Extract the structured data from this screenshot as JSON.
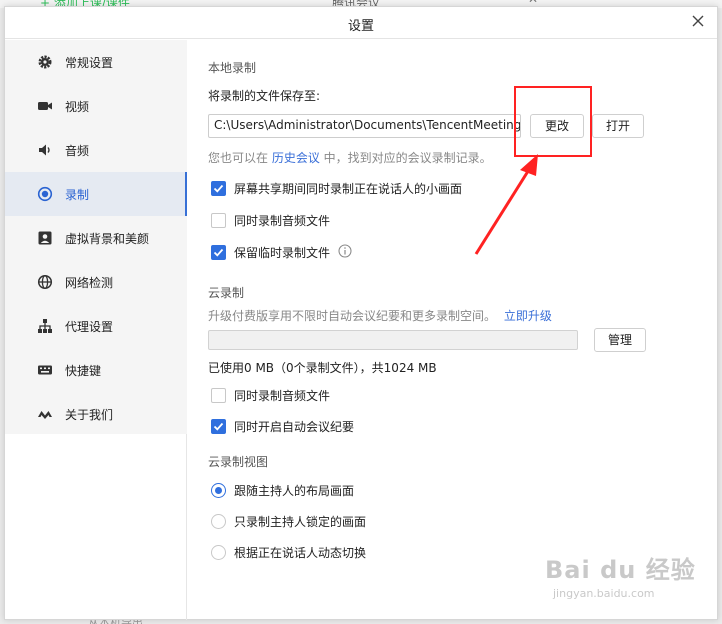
{
  "background": {
    "left_text": "+ 添加上课/课件",
    "center_text": "腾讯会议",
    "bottom_text": "从本机导出"
  },
  "dialog": {
    "title": "设置"
  },
  "sidebar": {
    "items": [
      {
        "label": "常规设置",
        "icon": "gear-icon"
      },
      {
        "label": "视频",
        "icon": "video-camera-icon"
      },
      {
        "label": "音频",
        "icon": "speaker-icon"
      },
      {
        "label": "录制",
        "icon": "record-icon",
        "active": true
      },
      {
        "label": "虚拟背景和美颜",
        "icon": "portrait-icon"
      },
      {
        "label": "网络检测",
        "icon": "globe-icon"
      },
      {
        "label": "代理设置",
        "icon": "network-tree-icon"
      },
      {
        "label": "快捷键",
        "icon": "keyboard-icon"
      },
      {
        "label": "关于我们",
        "icon": "brand-logo-icon"
      }
    ]
  },
  "local_recording": {
    "section_title": "本地录制",
    "save_to_label": "将录制的文件保存至:",
    "path_value": "C:\\Users\\Administrator\\Documents\\TencentMeeting",
    "change_button": "更改",
    "open_button": "打开",
    "hint_prefix": "您也可以在 ",
    "hint_link": "历史会议",
    "hint_suffix": " 中，找到对应的会议录制记录。",
    "options": [
      {
        "label": "屏幕共享期间同时录制正在说话人的小画面",
        "checked": true
      },
      {
        "label": "同时录制音频文件",
        "checked": false
      },
      {
        "label": "保留临时录制文件",
        "checked": true
      }
    ]
  },
  "cloud_recording": {
    "section_title": "云录制",
    "upgrade_text": "升级付费版享用不限时自动会议纪要和更多录制空间。",
    "upgrade_link": "立即升级",
    "storage_used_fraction": 0,
    "manage_button": "管理",
    "usage_text": "已使用0 MB（0个录制文件），共1024 MB",
    "options": [
      {
        "label": "同时录制音频文件",
        "checked": false
      },
      {
        "label": "同时开启自动会议纪要",
        "checked": true
      }
    ]
  },
  "cloud_view": {
    "section_title": "云录制视图",
    "options": [
      {
        "label": "跟随主持人的布局画面",
        "selected": true
      },
      {
        "label": "只录制主持人锁定的画面",
        "selected": false
      },
      {
        "label": "根据正在说话人动态切换",
        "selected": false
      }
    ]
  },
  "watermark": {
    "logo": "Bai du 经验",
    "url": "jingyan.baidu.com"
  },
  "colors": {
    "accent": "#2f6fde",
    "annotation": "#ff2222"
  }
}
